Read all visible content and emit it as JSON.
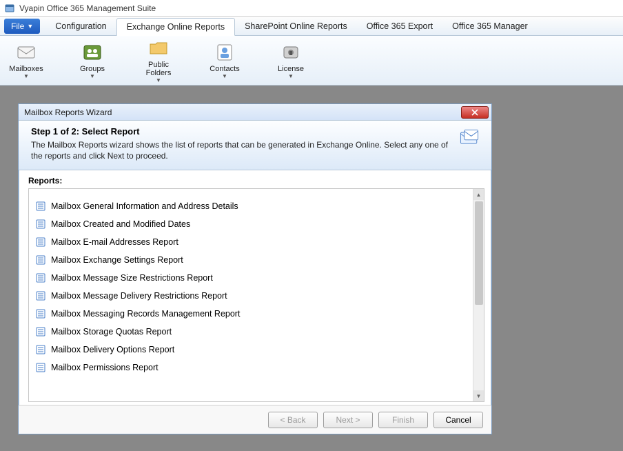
{
  "app": {
    "title": "Vyapin Office 365 Management Suite"
  },
  "menu": {
    "file": "File"
  },
  "tabs": [
    {
      "label": "Configuration",
      "active": false
    },
    {
      "label": "Exchange Online Reports",
      "active": true
    },
    {
      "label": "SharePoint Online Reports",
      "active": false
    },
    {
      "label": "Office 365 Export",
      "active": false
    },
    {
      "label": "Office 365 Manager",
      "active": false
    }
  ],
  "ribbon": [
    {
      "label": "Mailboxes",
      "icon": "mailboxes"
    },
    {
      "label": "Groups",
      "icon": "groups"
    },
    {
      "label": "Public\nFolders",
      "icon": "folders"
    },
    {
      "label": "Contacts",
      "icon": "contacts"
    },
    {
      "label": "License",
      "icon": "license"
    }
  ],
  "wizard": {
    "title": "Mailbox Reports Wizard",
    "step_title": "Step 1 of 2: Select Report",
    "step_desc": "The Mailbox Reports wizard shows the list of reports that can be generated in Exchange Online. Select any one of the reports and click Next to proceed.",
    "reports_label": "Reports:",
    "reports": [
      "Mailbox General Information and Address Details",
      "Mailbox Created and Modified Dates",
      "Mailbox E-mail Addresses Report",
      "Mailbox Exchange Settings Report",
      "Mailbox Message Size Restrictions Report",
      "Mailbox Message Delivery Restrictions Report",
      "Mailbox Messaging Records Management Report",
      "Mailbox Storage Quotas Report",
      "Mailbox Delivery Options Report",
      "Mailbox Permissions Report"
    ],
    "buttons": {
      "back": "< Back",
      "next": "Next >",
      "finish": "Finish",
      "cancel": "Cancel"
    }
  }
}
